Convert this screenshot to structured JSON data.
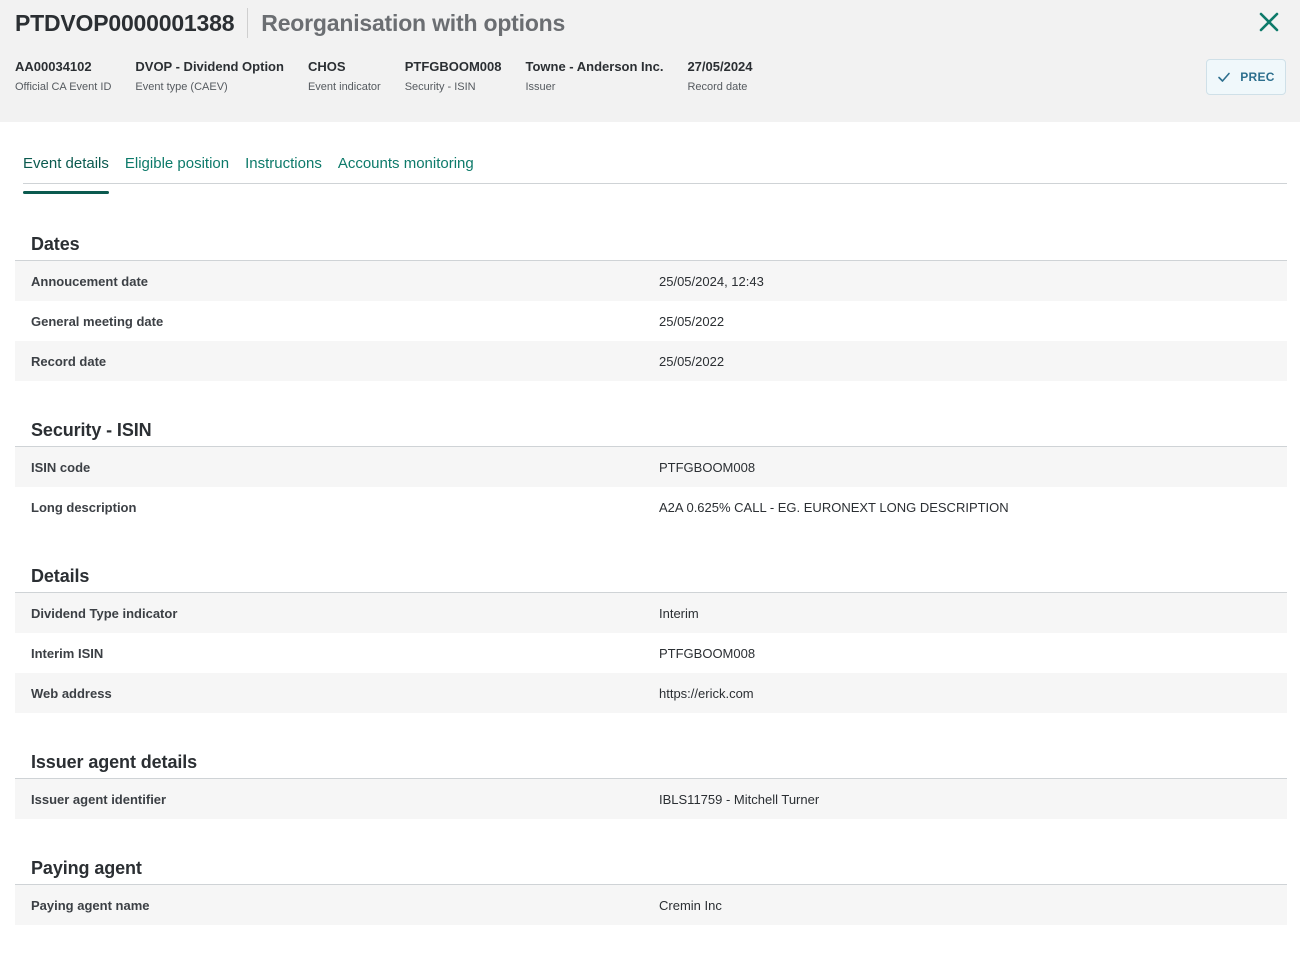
{
  "header": {
    "event_id": "PTDVOP0000001388",
    "title": "Reorganisation with options",
    "meta": [
      {
        "value": "AA00034102",
        "label": "Official CA Event ID"
      },
      {
        "value": "DVOP - Dividend Option",
        "label": "Event type (CAEV)"
      },
      {
        "value": "CHOS",
        "label": "Event indicator"
      },
      {
        "value": "PTFGBOOM008",
        "label": "Security - ISIN"
      },
      {
        "value": "Towne - Anderson Inc.",
        "label": "Issuer"
      },
      {
        "value": "27/05/2024",
        "label": "Record date"
      }
    ],
    "status": "PREC"
  },
  "tabs": [
    {
      "label": "Event details",
      "active": true
    },
    {
      "label": "Eligible position",
      "active": false
    },
    {
      "label": "Instructions",
      "active": false
    },
    {
      "label": "Accounts monitoring",
      "active": false
    }
  ],
  "sections": [
    {
      "title": "Dates",
      "rows": [
        {
          "label": "Annoucement date",
          "value": "25/05/2024, 12:43"
        },
        {
          "label": "General meeting date",
          "value": "25/05/2022"
        },
        {
          "label": "Record date",
          "value": "25/05/2022"
        }
      ]
    },
    {
      "title": "Security - ISIN",
      "rows": [
        {
          "label": "ISIN code",
          "value": "PTFGBOOM008"
        },
        {
          "label": "Long description",
          "value": "A2A 0.625% CALL - EG. EURONEXT LONG DESCRIPTION"
        }
      ]
    },
    {
      "title": "Details",
      "rows": [
        {
          "label": "Dividend Type indicator",
          "value": "Interim"
        },
        {
          "label": "Interim ISIN",
          "value": "PTFGBOOM008"
        },
        {
          "label": "Web address",
          "value": "https://erick.com"
        }
      ]
    },
    {
      "title": "Issuer agent details",
      "rows": [
        {
          "label": "Issuer agent identifier",
          "value": "IBLS11759 - Mitchell Turner"
        }
      ]
    },
    {
      "title": "Paying agent",
      "rows": [
        {
          "label": "Paying agent name",
          "value": "Cremin Inc"
        }
      ]
    }
  ],
  "colors": {
    "accent": "#0d7a6a",
    "header_bg": "#f2f2f2",
    "status_text": "#2d6f8e"
  }
}
